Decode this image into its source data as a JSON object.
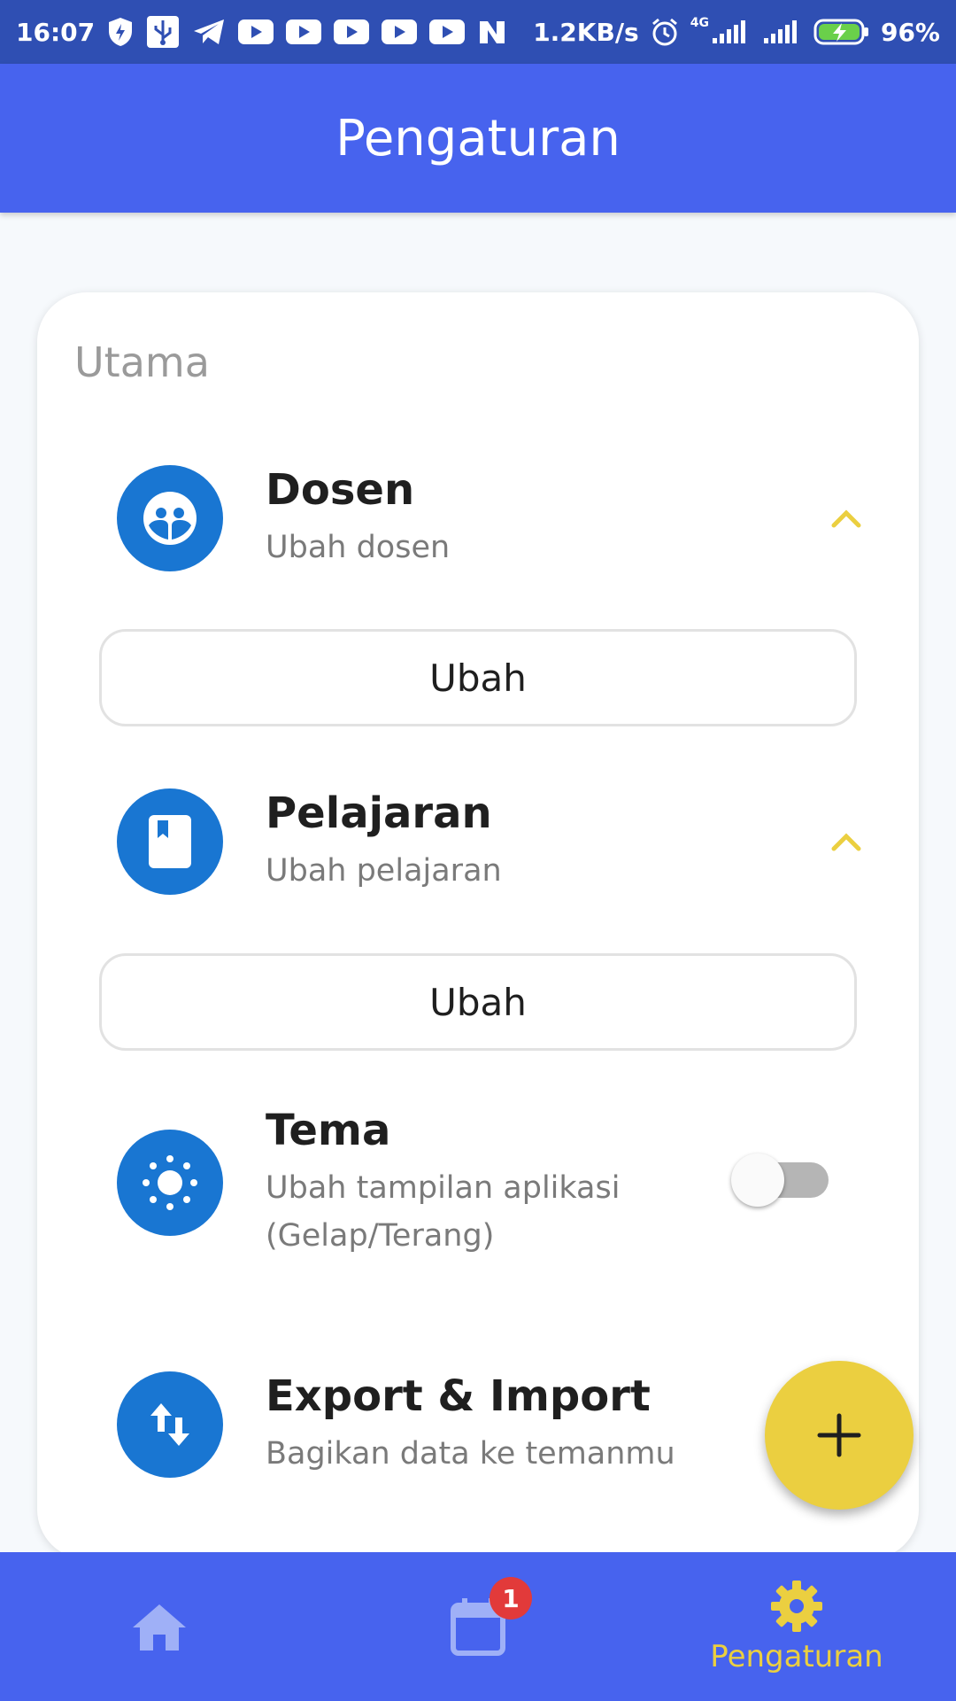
{
  "status_bar": {
    "time": "16:07",
    "net_speed": "1.2KB/s",
    "network_type": "4G",
    "battery": "96%"
  },
  "app_bar": {
    "title": "Pengaturan"
  },
  "card": {
    "section_title": "Utama",
    "items": [
      {
        "title": "Dosen",
        "subtitle": "Ubah dosen",
        "icon": "people-icon",
        "button_label": "Ubah"
      },
      {
        "title": "Pelajaran",
        "subtitle": "Ubah pelajaran",
        "icon": "book-icon",
        "button_label": "Ubah"
      },
      {
        "title": "Tema",
        "subtitle_line1": "Ubah tampilan aplikasi",
        "subtitle_line2": "(Gelap/Terang)",
        "icon": "brightness-icon",
        "toggle_on": false
      },
      {
        "title": "Export & Import",
        "subtitle": "Bagikan data ke temanmu",
        "icon": "swap-vertical-icon"
      }
    ]
  },
  "fab": {
    "icon": "plus-icon"
  },
  "bottom_nav": {
    "items": [
      {
        "icon": "home-icon"
      },
      {
        "icon": "calendar-icon",
        "badge": "1"
      },
      {
        "icon": "gear-icon",
        "label": "Pengaturan"
      }
    ]
  },
  "colors": {
    "primary": "#4763ee",
    "accent": "#ebcf40",
    "icon_bg": "#1976d2",
    "badge": "#e23a3a"
  }
}
